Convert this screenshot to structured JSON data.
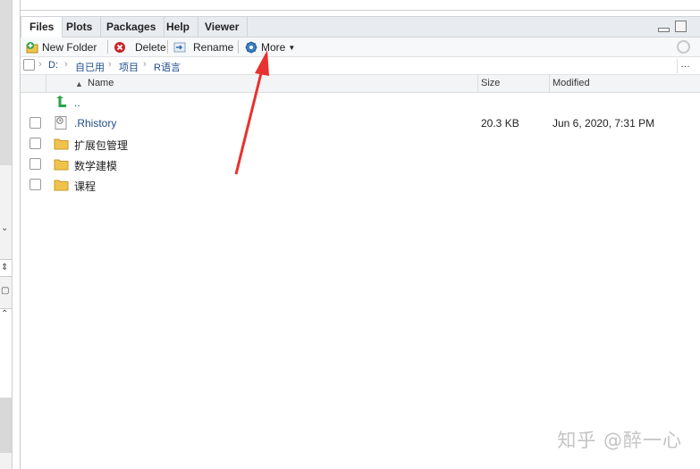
{
  "tabs": [
    {
      "label": "Files",
      "active": true
    },
    {
      "label": "Plots",
      "active": false
    },
    {
      "label": "Packages",
      "active": false
    },
    {
      "label": "Help",
      "active": false
    },
    {
      "label": "Viewer",
      "active": false
    }
  ],
  "toolbar": {
    "new_folder": "New Folder",
    "delete": "Delete",
    "rename": "Rename",
    "more": "More"
  },
  "breadcrumb": [
    "D:",
    "自已用",
    "项目",
    "R语言"
  ],
  "columns": {
    "name": "Name",
    "size": "Size",
    "modified": "Modified"
  },
  "parent_dir": "..",
  "files": [
    {
      "name": ".Rhistory",
      "size": "20.3 KB",
      "modified": "Jun 6, 2020, 7:31 PM",
      "type": "file"
    },
    {
      "name": "扩展包管理",
      "size": "",
      "modified": "",
      "type": "folder"
    },
    {
      "name": "数学建模",
      "size": "",
      "modified": "",
      "type": "folder"
    },
    {
      "name": "课程",
      "size": "",
      "modified": "",
      "type": "folder"
    }
  ],
  "watermark": "知乎 @醉一心",
  "colors": {
    "accent_link": "#1f4d8a",
    "arrow": "#e8322f",
    "folder": "#f0c44c"
  }
}
